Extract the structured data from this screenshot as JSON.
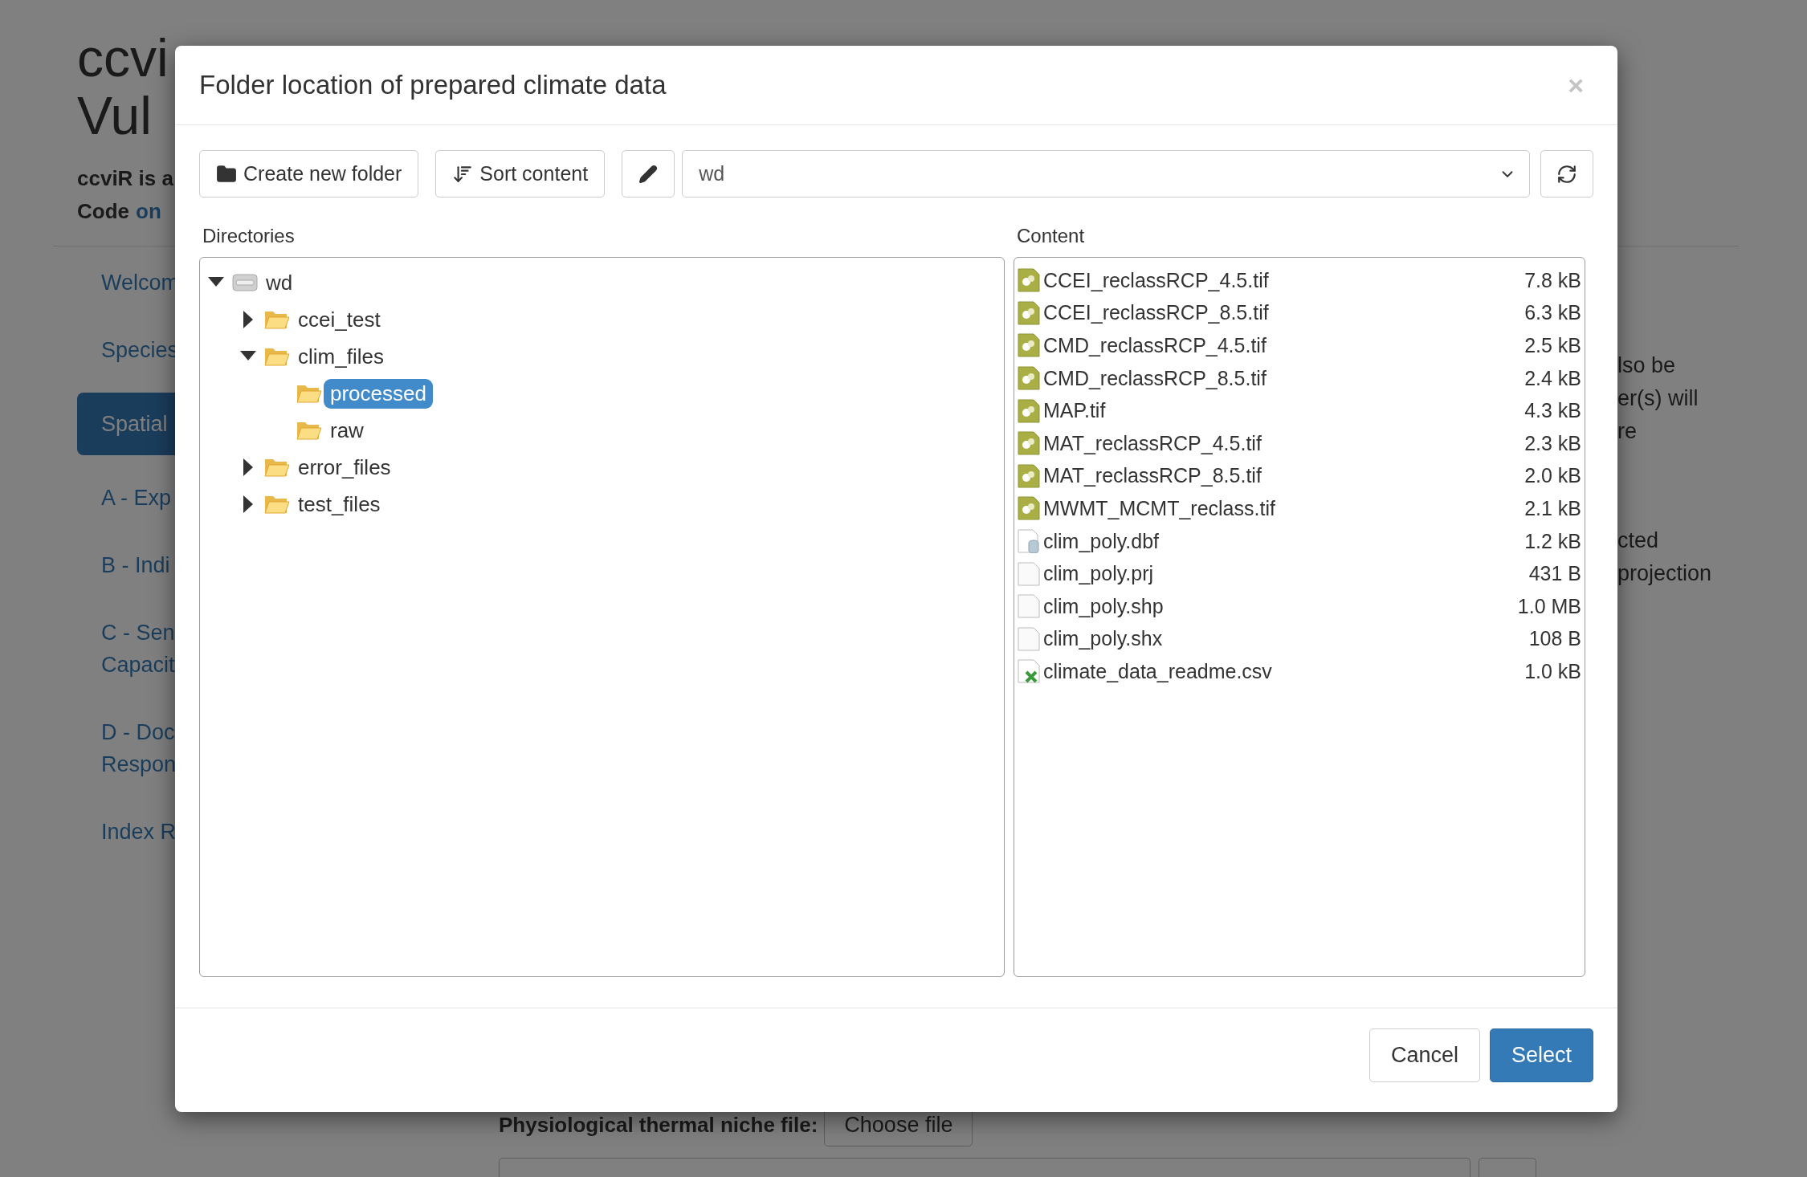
{
  "page": {
    "title_lines": [
      "ccvi",
      "Vul"
    ],
    "intro_lines": [
      {
        "text": "ccviR is a"
      },
      {
        "text": "Code",
        "link": "on"
      }
    ],
    "sidebar": {
      "items": [
        {
          "lines": [
            "Welcom"
          ],
          "selected": false
        },
        {
          "lines": [
            "Species"
          ],
          "selected": false
        },
        {
          "lines": [
            "Spatial"
          ],
          "selected": true
        },
        {
          "lines": [
            "A - Exp"
          ],
          "selected": false
        },
        {
          "lines": [
            "B - Indi"
          ],
          "selected": false
        },
        {
          "lines": [
            "C - Sen",
            "Capacit"
          ],
          "selected": false
        },
        {
          "lines": [
            "D - Doc",
            "Respon"
          ],
          "selected": false
        },
        {
          "lines": [
            "Index R"
          ],
          "selected": false
        }
      ]
    },
    "side_paragraphs": [
      [
        "lso be",
        "er(s) will",
        "re"
      ],
      [
        "cted",
        "projection"
      ]
    ],
    "file_form": {
      "label": "Physiological thermal niche file:",
      "button": "Choose file"
    }
  },
  "modal": {
    "title": "Folder location of prepared climate data",
    "close": "×",
    "toolbar": {
      "create_button": "Create new folder",
      "sort_button": "Sort content",
      "path_select": {
        "value": "wd"
      }
    },
    "directories": {
      "label": "Directories",
      "tree": [
        {
          "name": "wd",
          "kind": "drive",
          "expanded": true,
          "selected": false,
          "children": [
            {
              "name": "ccei_test",
              "kind": "folder",
              "expanded": false,
              "selected": false
            },
            {
              "name": "clim_files",
              "kind": "folder",
              "expanded": true,
              "selected": false,
              "children": [
                {
                  "name": "processed",
                  "kind": "folder",
                  "selected": true
                },
                {
                  "name": "raw",
                  "kind": "folder",
                  "selected": false
                }
              ]
            },
            {
              "name": "error_files",
              "kind": "folder",
              "expanded": false,
              "selected": false
            },
            {
              "name": "test_files",
              "kind": "folder",
              "expanded": false,
              "selected": false
            }
          ]
        }
      ]
    },
    "content": {
      "label": "Content",
      "files": [
        {
          "name": "CCEI_reclassRCP_4.5.tif",
          "size": "7.8 kB",
          "kind": "raster"
        },
        {
          "name": "CCEI_reclassRCP_8.5.tif",
          "size": "6.3 kB",
          "kind": "raster"
        },
        {
          "name": "CMD_reclassRCP_4.5.tif",
          "size": "2.5 kB",
          "kind": "raster"
        },
        {
          "name": "CMD_reclassRCP_8.5.tif",
          "size": "2.4 kB",
          "kind": "raster"
        },
        {
          "name": "MAP.tif",
          "size": "4.3 kB",
          "kind": "raster"
        },
        {
          "name": "MAT_reclassRCP_4.5.tif",
          "size": "2.3 kB",
          "kind": "raster"
        },
        {
          "name": "MAT_reclassRCP_8.5.tif",
          "size": "2.0 kB",
          "kind": "raster"
        },
        {
          "name": "MWMT_MCMT_reclass.tif",
          "size": "2.1 kB",
          "kind": "raster"
        },
        {
          "name": "clim_poly.dbf",
          "size": "1.2 kB",
          "kind": "database"
        },
        {
          "name": "clim_poly.prj",
          "size": "431 B",
          "kind": "blank"
        },
        {
          "name": "clim_poly.shp",
          "size": "1.0 MB",
          "kind": "blank"
        },
        {
          "name": "clim_poly.shx",
          "size": "108 B",
          "kind": "blank"
        },
        {
          "name": "climate_data_readme.csv",
          "size": "1.0 kB",
          "kind": "spreadsheet"
        }
      ]
    },
    "buttons": [
      {
        "label": "Cancel",
        "kind": "default"
      },
      {
        "label": "Select",
        "kind": "primary"
      }
    ]
  }
}
